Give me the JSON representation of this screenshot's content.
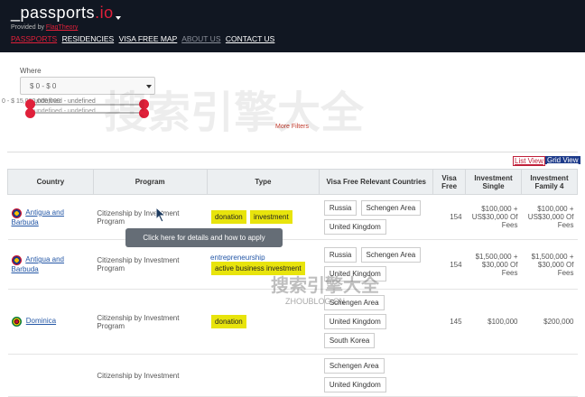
{
  "header": {
    "logo_main": "_passports",
    "logo_io": ".io",
    "provided_prefix": "Provided by",
    "provided_link": "FlagTheory",
    "nav": [
      "PASSPORTS",
      "RESIDENCIES",
      "VISA FREE MAP",
      "ABOUT US",
      "CONTACT US"
    ]
  },
  "filters": {
    "where_label": "Where",
    "where_value": "$ 0 - $ 0",
    "range_text_1": "0 - $ 15,000,000,000",
    "range_text_2": "undefined - undefined",
    "range_text_3": "undefined - undefined",
    "more_filters": "More Filters"
  },
  "views": {
    "list": "List View",
    "grid": "Grid View"
  },
  "table": {
    "headers": [
      "Country",
      "Program",
      "Type",
      "Visa Free Relevant Countries",
      "Visa Free",
      "Investment Single",
      "Investment Family 4"
    ],
    "rows": [
      {
        "country": "Antigua and Barbuda",
        "program": "Citizenship by Investment Program",
        "types": [
          "donation",
          "investment"
        ],
        "visa_countries": [
          "Russia",
          "Schengen Area",
          "United Kingdom"
        ],
        "visa_free": "154",
        "inv_single": "$100,000 + US$30,000 Of Fees",
        "inv_family": "$100,000 + US$30,000 Of Fees"
      },
      {
        "country": "Antigua and Barbuda",
        "program": "Citizenship by Investment Program",
        "types": [
          "entrepreneurship",
          "active business investment"
        ],
        "visa_countries": [
          "Russia",
          "Schengen Area",
          "United Kingdom"
        ],
        "visa_free": "154",
        "inv_single": "$1,500,000 + $30,000 Of Fees",
        "inv_family": "$1,500,000 + $30,000 Of Fees"
      },
      {
        "country": "Dominica",
        "program": "Citizenship by Investment Program",
        "types": [
          "donation"
        ],
        "visa_countries": [
          "Schengen Area",
          "United Kingdom",
          "South Korea"
        ],
        "visa_free": "145",
        "inv_single": "$100,000",
        "inv_family": "$200,000"
      },
      {
        "country": "",
        "program": "Citizenship by Investment",
        "types": [],
        "visa_countries": [
          "Schengen Area",
          "United Kingdom"
        ],
        "visa_free": "",
        "inv_single": "",
        "inv_family": ""
      }
    ]
  },
  "tooltip": "Click here for details and how to apply",
  "watermark": {
    "big": "搜索引擎大全",
    "small": "ZHOUBLOG.CN"
  },
  "colors": {
    "header_bg": "#111722",
    "accent": "#e0203a",
    "tag": "#e8e40c",
    "link": "#2457a6"
  }
}
